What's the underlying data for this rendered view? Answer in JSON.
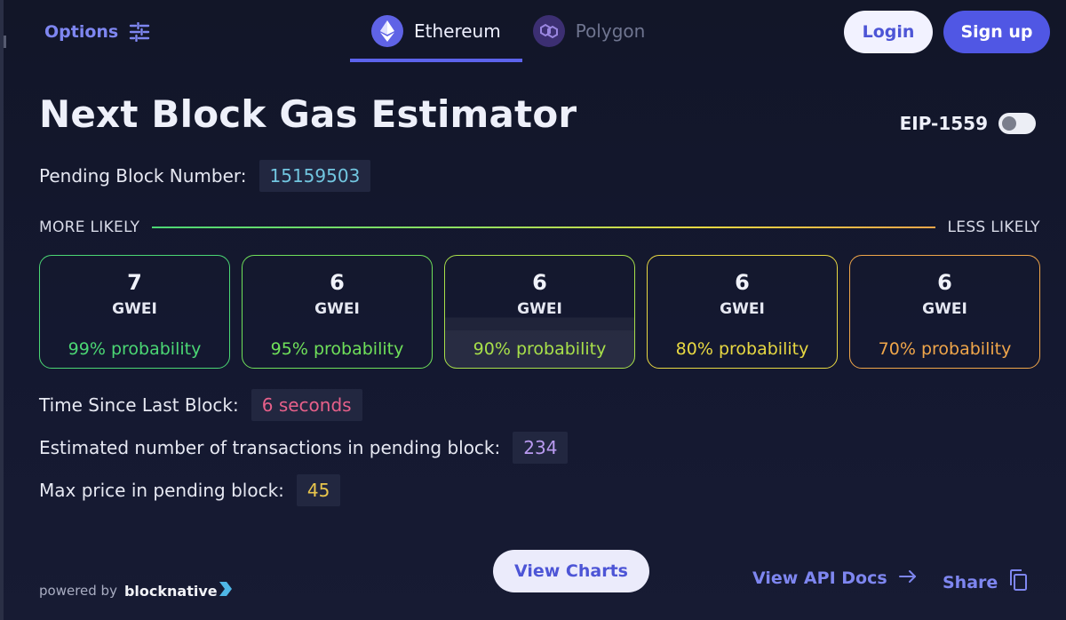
{
  "topbar": {
    "options_label": "Options",
    "tabs": [
      {
        "label": "Ethereum",
        "icon": "ethereum-icon",
        "active": true
      },
      {
        "label": "Polygon",
        "icon": "polygon-icon",
        "active": false
      }
    ],
    "login_label": "Login",
    "signup_label": "Sign up"
  },
  "main": {
    "title": "Next Block Gas Estimator",
    "eip_label": "EIP-1559",
    "eip_enabled": false,
    "pending_block_label": "Pending Block Number:",
    "pending_block_value": "15159503",
    "more_likely_label": "MORE LIKELY",
    "less_likely_label": "LESS LIKELY",
    "estimates": [
      {
        "gwei": "7",
        "unit": "GWEI",
        "probability": "99% probability",
        "color": "#4bd774"
      },
      {
        "gwei": "6",
        "unit": "GWEI",
        "probability": "95% probability",
        "color": "#6fe05a"
      },
      {
        "gwei": "6",
        "unit": "GWEI",
        "probability": "90% probability",
        "color": "#a8e04a",
        "selected": true
      },
      {
        "gwei": "6",
        "unit": "GWEI",
        "probability": "80% probability",
        "color": "#e8d842"
      },
      {
        "gwei": "6",
        "unit": "GWEI",
        "probability": "70% probability",
        "color": "#f0a64a"
      }
    ],
    "time_since_label": "Time Since Last Block:",
    "time_since_value": "6 seconds",
    "tx_count_label": "Estimated number of transactions in pending block:",
    "tx_count_value": "234",
    "max_price_label": "Max price in pending block:",
    "max_price_value": "45"
  },
  "footer": {
    "powered_by": "powered by",
    "brand": "blocknative",
    "view_charts_label": "View Charts",
    "api_docs_label": "View API Docs",
    "share_label": "Share"
  },
  "colors": {
    "accent": "#5057e4",
    "link": "#7e86f0",
    "background": "#141830"
  }
}
